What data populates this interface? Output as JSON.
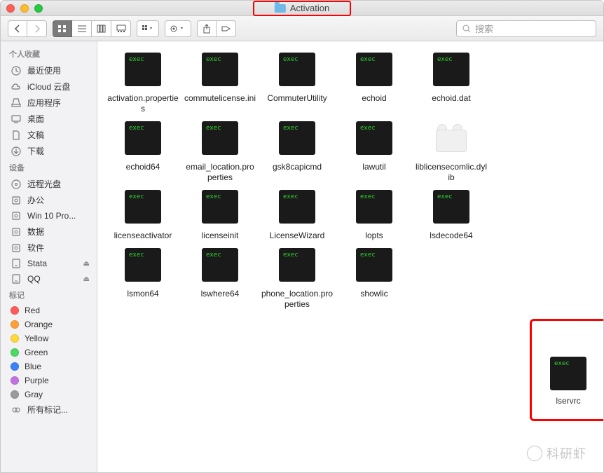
{
  "window": {
    "title": "Activation"
  },
  "search": {
    "placeholder": "搜索"
  },
  "sidebar": {
    "sections": [
      {
        "header": "个人收藏",
        "items": [
          {
            "icon": "clock",
            "label": "最近使用"
          },
          {
            "icon": "cloud",
            "label": "iCloud 云盘"
          },
          {
            "icon": "apps",
            "label": "应用程序"
          },
          {
            "icon": "desktop",
            "label": "桌面"
          },
          {
            "icon": "doc",
            "label": "文稿"
          },
          {
            "icon": "download",
            "label": "下载"
          }
        ]
      },
      {
        "header": "设备",
        "items": [
          {
            "icon": "disc",
            "label": "远程光盘"
          },
          {
            "icon": "hdd",
            "label": "办公"
          },
          {
            "icon": "hdd",
            "label": "Win 10 Pro..."
          },
          {
            "icon": "hdd",
            "label": "数据"
          },
          {
            "icon": "hdd",
            "label": "软件"
          },
          {
            "icon": "ext",
            "label": "Stata",
            "eject": true
          },
          {
            "icon": "ext",
            "label": "QQ",
            "eject": true
          }
        ]
      },
      {
        "header": "标记",
        "items": [
          {
            "tag": "#ff5b5b",
            "label": "Red"
          },
          {
            "tag": "#ff9f3c",
            "label": "Orange"
          },
          {
            "tag": "#ffd93c",
            "label": "Yellow"
          },
          {
            "tag": "#4cd964",
            "label": "Green"
          },
          {
            "tag": "#3a82f7",
            "label": "Blue"
          },
          {
            "tag": "#c373e0",
            "label": "Purple"
          },
          {
            "tag": "#9a9a9a",
            "label": "Gray"
          },
          {
            "icon": "alltags",
            "label": "所有标记..."
          }
        ]
      }
    ]
  },
  "files": [
    {
      "type": "exec",
      "name": "activation.properties"
    },
    {
      "type": "exec",
      "name": "commutelicense.ini"
    },
    {
      "type": "exec",
      "name": "CommuterUtility"
    },
    {
      "type": "exec",
      "name": "echoid"
    },
    {
      "type": "exec",
      "name": "echoid.dat"
    },
    {
      "type": "exec",
      "name": "echoid64"
    },
    {
      "type": "exec",
      "name": "email_location.properties"
    },
    {
      "type": "exec",
      "name": "gsk8capicmd"
    },
    {
      "type": "exec",
      "name": "lawutil"
    },
    {
      "type": "lego",
      "name": "liblicensecomlic.dylib"
    },
    {
      "type": "exec",
      "name": "licenseactivator"
    },
    {
      "type": "exec",
      "name": "licenseinit"
    },
    {
      "type": "exec",
      "name": "LicenseWizard"
    },
    {
      "type": "exec",
      "name": "lopts"
    },
    {
      "type": "exec",
      "name": "lsdecode64"
    },
    {
      "type": "exec",
      "name": "lsmon64"
    },
    {
      "type": "exec",
      "name": "lswhere64"
    },
    {
      "type": "exec",
      "name": "phone_location.properties"
    },
    {
      "type": "exec",
      "name": "showlic"
    }
  ],
  "dragged": {
    "name": "lservrc",
    "type": "exec"
  },
  "watermark": "科研虾"
}
